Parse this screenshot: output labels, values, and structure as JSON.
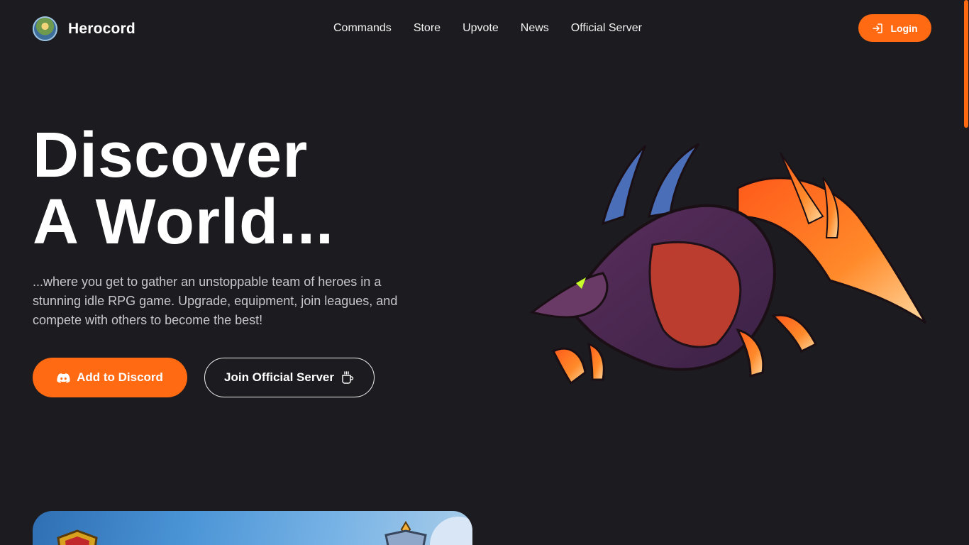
{
  "header": {
    "brand": "Herocord",
    "nav": [
      "Commands",
      "Store",
      "Upvote",
      "News",
      "Official Server"
    ],
    "login_label": "Login"
  },
  "hero": {
    "title_line1": "Discover",
    "title_line2": "A World...",
    "description": "...where you get to gather an unstoppable team of heroes in a stunning idle RPG game. Upgrade, equipment, join leagues, and compete with others to become the best!",
    "primary_button": "Add to Discord",
    "secondary_button": "Join Official Server"
  },
  "icons": {
    "brand": "herocord-logo",
    "login": "login-icon",
    "discord": "discord-icon",
    "server": "mug-icon",
    "illustration": "dragon-illustration"
  },
  "colors": {
    "background": "#1c1b1f",
    "accent": "#ff6a13",
    "text": "#ffffff",
    "muted_text": "#c7c7cc"
  }
}
